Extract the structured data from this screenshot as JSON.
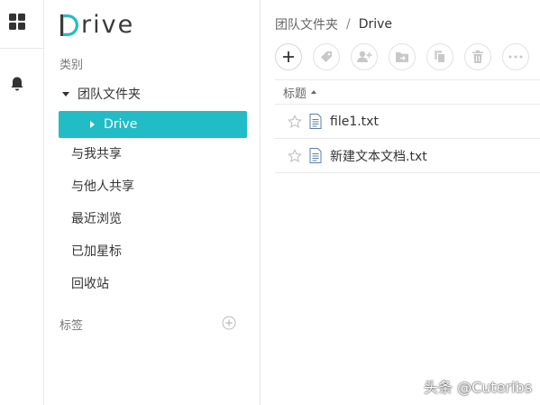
{
  "rail": {
    "icons": [
      "apps-icon",
      "bell-icon"
    ]
  },
  "logo": {
    "letter": "D",
    "rest": "rive"
  },
  "sidebar": {
    "category_label": "类别",
    "tree_parent": "团队文件夹",
    "active_item": "Drive",
    "items": [
      {
        "label": "与我共享"
      },
      {
        "label": "与他人共享"
      },
      {
        "label": "最近浏览"
      },
      {
        "label": "已加星标"
      },
      {
        "label": "回收站"
      }
    ],
    "tags_label": "标签"
  },
  "breadcrumb": {
    "parent": "团队文件夹",
    "separator": "/",
    "current": "Drive"
  },
  "toolbar": {
    "buttons": [
      "add-icon",
      "tag-icon",
      "add-user-icon",
      "move-folder-icon",
      "copy-icon",
      "delete-icon",
      "more-icon"
    ]
  },
  "table": {
    "header": "标题",
    "rows": [
      {
        "name": "file1.txt"
      },
      {
        "name": "新建文本文档.txt"
      }
    ]
  },
  "watermark": "头条 @Cuteribs",
  "colors": {
    "accent": "#22bcc6",
    "border": "#e8e8e8",
    "text": "#333333"
  }
}
